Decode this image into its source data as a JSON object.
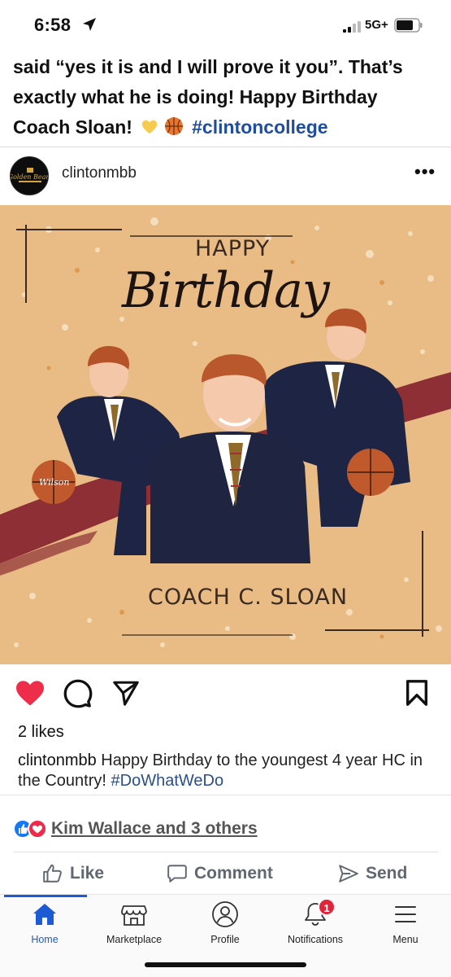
{
  "status_bar": {
    "time": "6:58",
    "network": "5G+"
  },
  "post": {
    "text_line1": "said “yes it is and I will prove it you”. That’s",
    "text_line2": "exactly what he is doing! Happy Birthday",
    "text_line3": "Coach Sloan!",
    "hashtag": "#clintoncollege"
  },
  "instagram": {
    "username": "clintonmbb",
    "avatar_text": "Golden Bears",
    "image": {
      "happy": "HAPPY",
      "birthday": "Birthday",
      "name": "COACH C. SLOAN",
      "ball_brand": "Wilson"
    },
    "likes": "2 likes",
    "caption_user": "clintonmbb",
    "caption_text": "Happy Birthday to the youngest 4 year HC in the Country!",
    "caption_hashtag": "#DoWhatWeDo"
  },
  "reactions": {
    "reactors": "Kim Wallace and 3 others"
  },
  "fb_actions": {
    "like": "Like",
    "comment": "Comment",
    "send": "Send"
  },
  "tabbar": {
    "home": "Home",
    "marketplace": "Marketplace",
    "profile": "Profile",
    "notifications": "Notifications",
    "notifications_badge": "1",
    "menu": "Menu"
  },
  "colors": {
    "hashtag": "#1f4e9c",
    "heart": "#ed2d49",
    "fb_blue": "#1877f2",
    "tab_active": "#1c5bd3",
    "image_bg": "#e8bc84"
  }
}
